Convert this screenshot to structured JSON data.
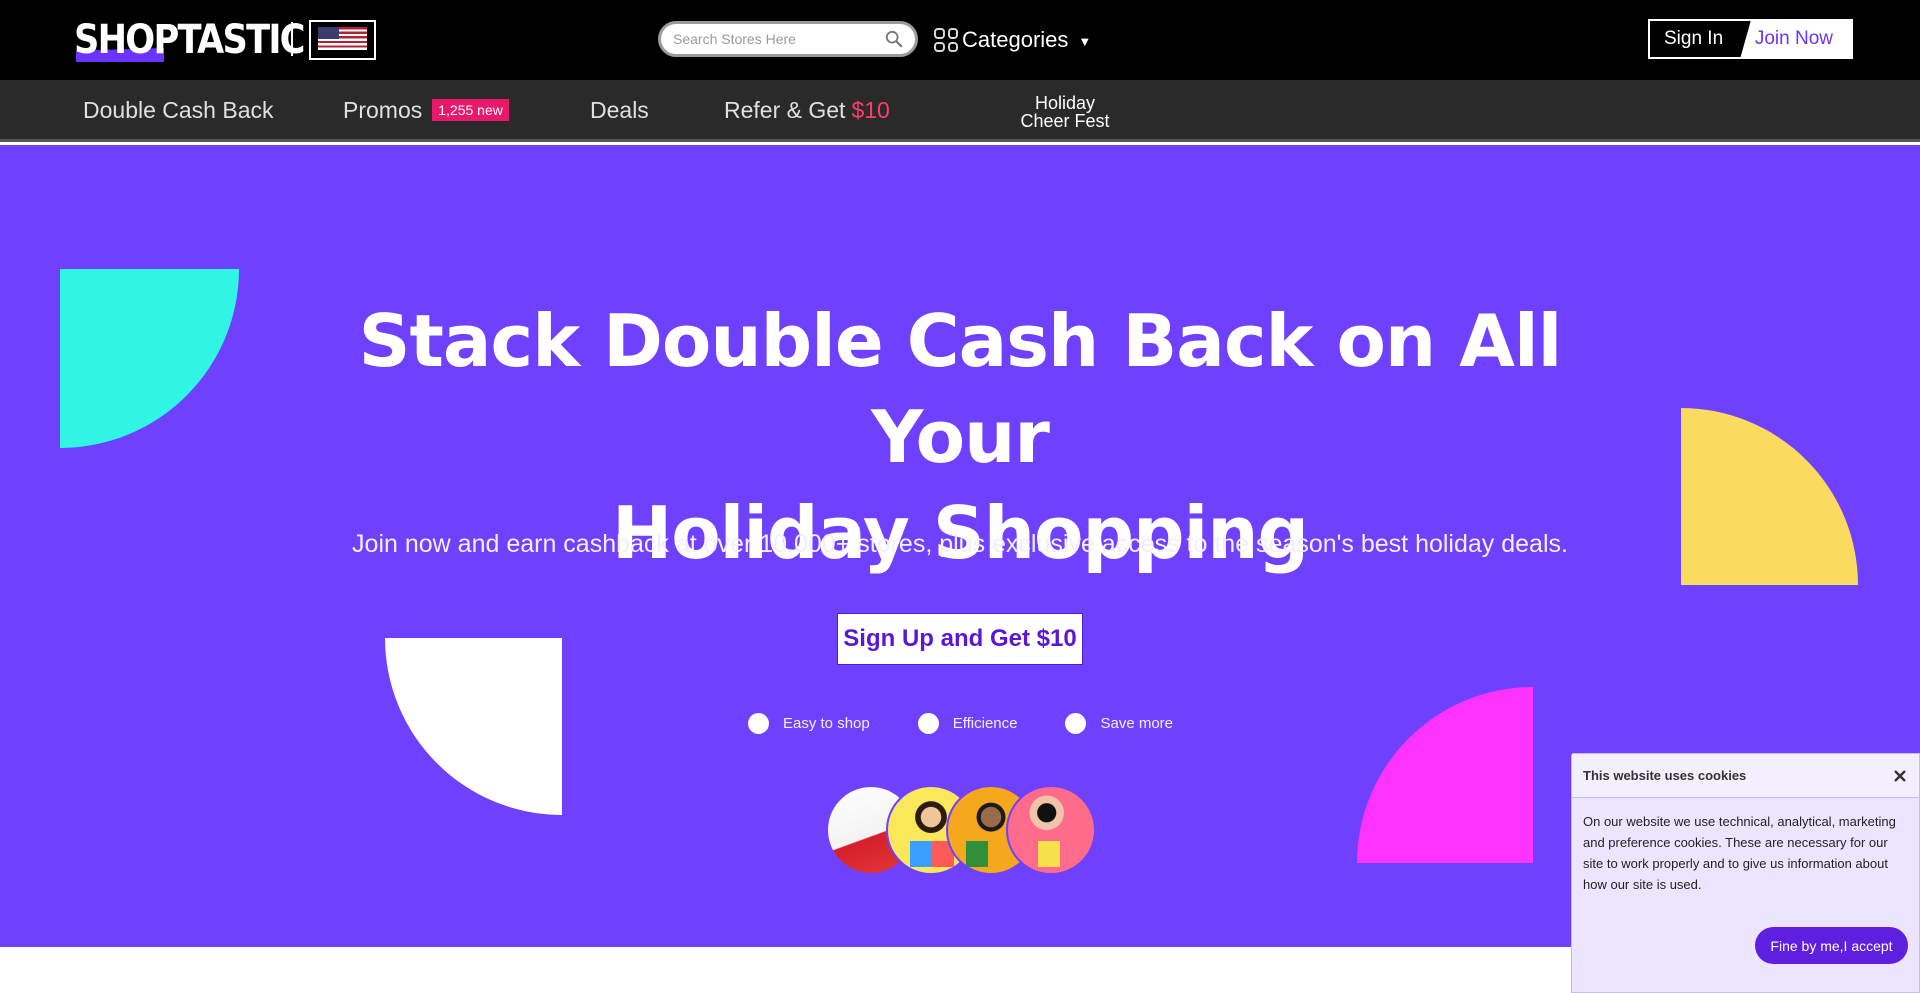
{
  "header": {
    "logo_text": "SHOPTASTIC",
    "flag_icon": "us-flag-icon",
    "search": {
      "placeholder": "Search Stores Here",
      "icon": "search-icon"
    },
    "categories_label": "Categories",
    "sign_in_label": "Sign In",
    "join_now_label": "Join Now"
  },
  "nav": {
    "items": [
      {
        "label": "Double Cash Back"
      },
      {
        "label": "Promos",
        "badge": "1,255 new"
      },
      {
        "label": "Deals"
      },
      {
        "label": "Refer & Get",
        "accent": "$10"
      }
    ],
    "holiday_line1": "Holiday",
    "holiday_line2": "Cheer Fest"
  },
  "hero": {
    "title_line1": "Stack Double Cash Back on All Your",
    "title_line2": "Holiday Shopping",
    "subtitle": "Join now and earn cashback at over 10,000+ stores, plus exclusive access to the season's best holiday deals.",
    "cta_label": "Sign Up and Get $10",
    "features": [
      "Easy to shop",
      "Efficience",
      "Save more"
    ]
  },
  "cookie": {
    "title": "This website uses cookies",
    "body": "On our website we use technical, analytical, marketing and preference cookies. These are necessary for our site to work properly and to give us information about how our site is used.",
    "accept_label": "Fine by me,I accept"
  },
  "colors": {
    "hero_bg": "#7040ff",
    "brand_purple": "#6b34ff",
    "badge_pink": "#e8196b",
    "shape_cyan": "#31f5e4",
    "shape_yellow": "#fadb5f",
    "shape_magenta": "#ff33ff"
  }
}
